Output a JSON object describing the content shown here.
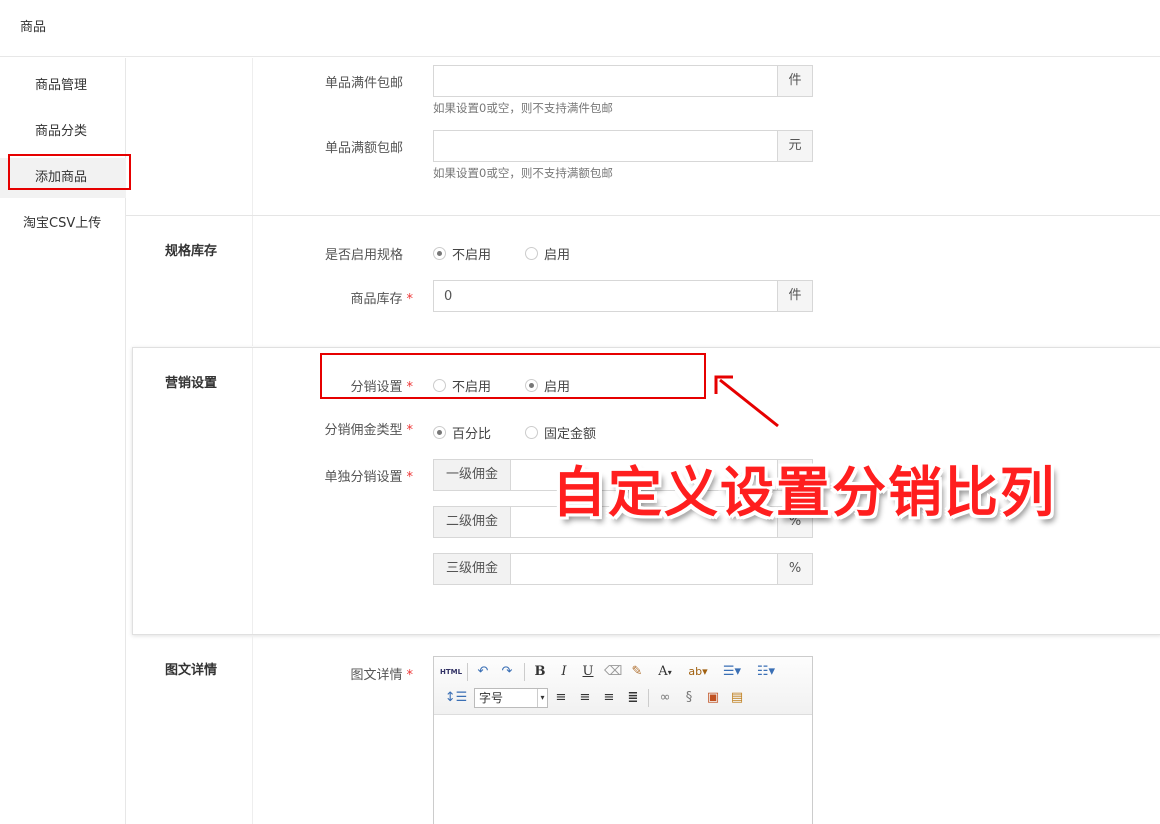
{
  "header": {
    "title": "商品"
  },
  "sidebar": {
    "items": [
      {
        "label": "商品管理"
      },
      {
        "label": "商品分类"
      },
      {
        "label": "添加商品"
      },
      {
        "label": "淘宝CSV上传"
      }
    ]
  },
  "shipping": {
    "full_count_label": "单品满件包邮",
    "full_count_value": "",
    "full_count_unit": "件",
    "full_count_help": "如果设置0或空，则不支持满件包邮",
    "full_amount_label": "单品满额包邮",
    "full_amount_value": "",
    "full_amount_unit": "元",
    "full_amount_help": "如果设置0或空，则不支持满额包邮"
  },
  "spec": {
    "section_title": "规格库存",
    "enable_label": "是否启用规格",
    "opt_off": "不启用",
    "opt_on": "启用",
    "selected": "不启用",
    "stock_label": "商品库存",
    "stock_value": "0",
    "stock_unit": "件"
  },
  "marketing": {
    "section_title": "营销设置",
    "dist_label": "分销设置",
    "dist_off": "不启用",
    "dist_on": "启用",
    "dist_selected": "启用",
    "commission_type_label": "分销佣金类型",
    "type_percent": "百分比",
    "type_fixed": "固定金额",
    "type_selected": "百分比",
    "single_label": "单独分销设置",
    "level1": "一级佣金",
    "level2": "二级佣金",
    "level3": "三级佣金",
    "percent_unit": "%",
    "required_mark": "*"
  },
  "annotation": {
    "text": "自定义设置分销比列"
  },
  "detail": {
    "section_title": "图文详情",
    "label": "图文详情",
    "toolbar": {
      "html": "HTML",
      "bold": "B",
      "italic": "I",
      "underline": "U",
      "font_color": "A",
      "font_size": "字号"
    }
  }
}
